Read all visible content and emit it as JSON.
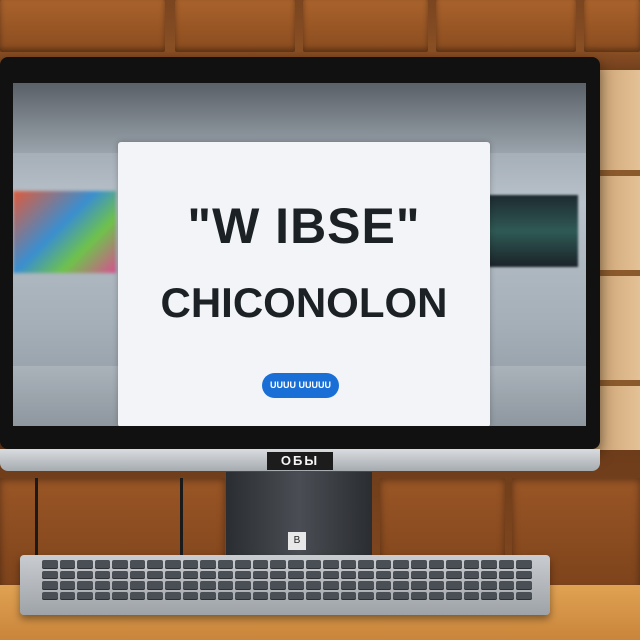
{
  "screen": {
    "dialog": {
      "title": "\"W IBSE\"",
      "subtitle": "CHICONOLON",
      "button_label": "UUUU UUUUU"
    }
  },
  "monitor": {
    "brand_label": "ОБЫ",
    "stand_port_label": "B"
  },
  "colors": {
    "dialog_bg": "#f2f4f7",
    "button": "#1a6fd6",
    "text": "#1b2124"
  }
}
